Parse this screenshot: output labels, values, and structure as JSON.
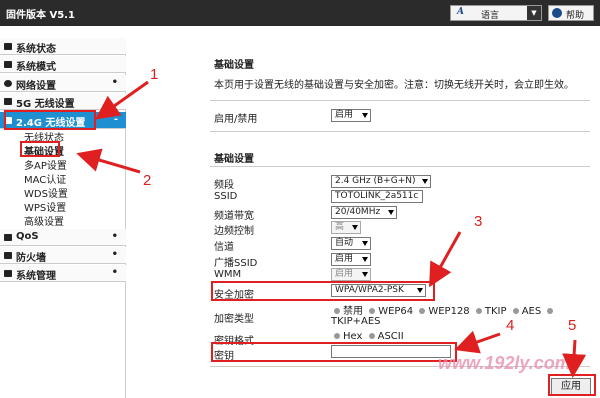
{
  "header": {
    "firmware": "固件版本 V5.1",
    "language_icon": "A",
    "language": "语言",
    "help": "帮助"
  },
  "sidebar": {
    "items": [
      {
        "label": "系统状态",
        "dot": ""
      },
      {
        "label": "系统模式",
        "dot": ""
      },
      {
        "label": "网络设置",
        "dot": "•"
      },
      {
        "label": "5G 无线设置",
        "dot": ""
      },
      {
        "label": "2.4G 无线设置",
        "dot": "-"
      },
      {
        "label": "QoS",
        "dot": "•"
      },
      {
        "label": "防火墙",
        "dot": "•"
      },
      {
        "label": "系统管理",
        "dot": "•"
      }
    ],
    "subitems": [
      "无线状态",
      "基础设置",
      "多AP设置",
      "MAC认证",
      "WDS设置",
      "WPS设置",
      "高级设置"
    ]
  },
  "section1": {
    "title": "基础设置",
    "desc": "本页用于设置无线的基础设置与安全加密。注意：切换无线开关时，会立即生效。",
    "enable_label": "启用/禁用",
    "enable_value": "启用"
  },
  "section2": {
    "title": "基础设置",
    "fields": {
      "band": {
        "label": "频段",
        "value": "2.4 GHz (B+G+N)"
      },
      "ssid": {
        "label": "SSID",
        "value": "TOTOLINK_2a511c"
      },
      "width": {
        "label": "频道带宽",
        "value": "20/40MHz"
      },
      "sideband": {
        "label": "边频控制",
        "value": "高"
      },
      "channel": {
        "label": "信道",
        "value": "自动"
      },
      "broadcast": {
        "label": "广播SSID",
        "value": "启用"
      },
      "wmm": {
        "label": "WMM",
        "value": "启用"
      },
      "security": {
        "label": "安全加密",
        "value": "WPA/WPA2-PSK"
      },
      "cipher": {
        "label": "加密类型",
        "options": [
          "禁用",
          "WEP64",
          "WEP128",
          "TKIP",
          "AES",
          "TKIP+AES"
        ]
      },
      "keyformat": {
        "label": "密钥格式",
        "options": [
          "Hex",
          "ASCII"
        ]
      },
      "key": {
        "label": "密钥",
        "value": ""
      }
    },
    "apply": "应用"
  },
  "annotations": [
    "1",
    "2",
    "3",
    "4",
    "5"
  ],
  "watermark": "www.192ly.com",
  "colors": {
    "topbar": "#2b2b2b",
    "active": "#1e8fd0",
    "annotation": "#e02020"
  }
}
